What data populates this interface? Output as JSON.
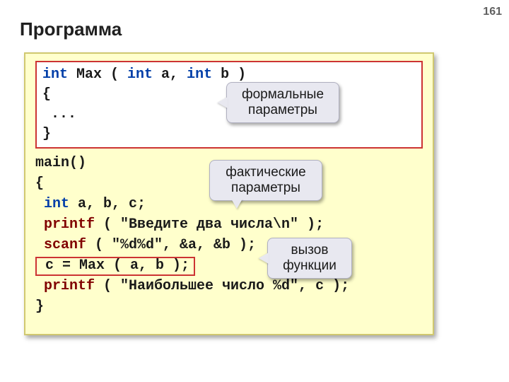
{
  "page_number": "161",
  "title": "Программа",
  "code": {
    "box1_l1_a": "int",
    "box1_l1_b": " Max ( ",
    "box1_l1_c": "int",
    "box1_l1_d": " a, ",
    "box1_l1_e": "int",
    "box1_l1_f": " b )",
    "box1_l2": "{",
    "box1_l3": " ...",
    "box1_l4": "}",
    "main_l1": "main()",
    "main_l2": "{",
    "main_l3_a": " int",
    "main_l3_b": " a, b, c;",
    "main_l4_a": " printf",
    "main_l4_b": " ( \"Введите два числа\\n\" );",
    "main_l5_a": " scanf",
    "main_l5_b": " ( \"%d%d\", &a, &b );",
    "call_line": " c = Max ( a, b );",
    "main_l7_a": " printf",
    "main_l7_b": " ( \"Наибольшее число %d\", c );",
    "main_l8": "}"
  },
  "callouts": {
    "c1_l1": "формальные",
    "c1_l2": "параметры",
    "c2_l1": "фактические",
    "c2_l2": "параметры",
    "c3_l1": "вызов",
    "c3_l2": "функции"
  }
}
